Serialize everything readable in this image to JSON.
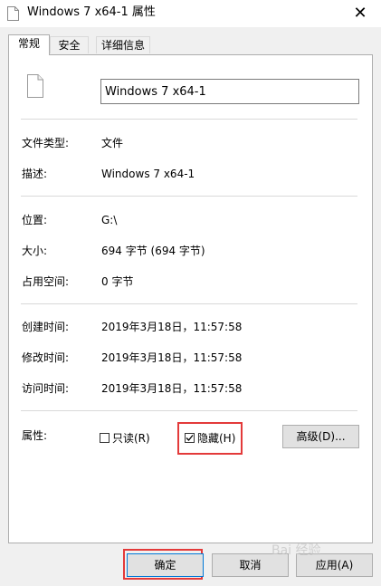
{
  "window": {
    "title": "Windows 7 x64-1 属性",
    "close_glyph": "✕"
  },
  "tabs": [
    {
      "label": "常规",
      "active": true
    },
    {
      "label": "安全",
      "active": false
    },
    {
      "label": "详细信息",
      "active": false
    }
  ],
  "general": {
    "file_name": "Windows 7 x64-1",
    "rows": {
      "type": {
        "label": "文件类型:",
        "value": "文件"
      },
      "desc": {
        "label": "描述:",
        "value": "Windows 7 x64-1"
      },
      "location": {
        "label": "位置:",
        "value": "G:\\"
      },
      "size": {
        "label": "大小:",
        "value": "694 字节 (694 字节)"
      },
      "disk_size": {
        "label": "占用空间:",
        "value": "0 字节"
      },
      "created": {
        "label": "创建时间:",
        "value": "2019年3月18日，11:57:58"
      },
      "modified": {
        "label": "修改时间:",
        "value": "2019年3月18日，11:57:58"
      },
      "accessed": {
        "label": "访问时间:",
        "value": "2019年3月18日，11:57:58"
      }
    },
    "attributes": {
      "label": "属性:",
      "readonly": {
        "label": "只读(R)",
        "checked": false
      },
      "hidden": {
        "label": "隐藏(H)",
        "checked": true
      },
      "advanced_label": "高级(D)..."
    }
  },
  "footer": {
    "ok_label": "确定",
    "cancel_label": "取消",
    "apply_label": "应用(A)"
  },
  "highlight_color": "#e33a3a",
  "watermark_text": "Bai 经验"
}
